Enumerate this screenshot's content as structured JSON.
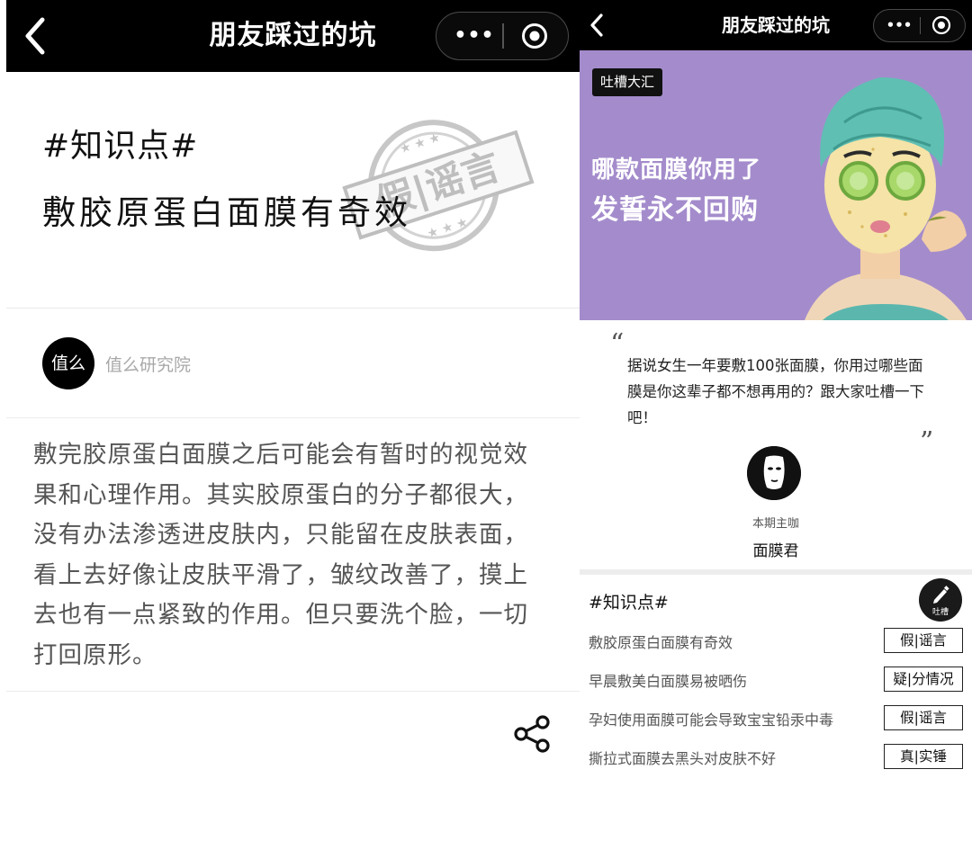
{
  "left": {
    "nav": {
      "title": "朋友踩过的坑",
      "more": "•••"
    },
    "hero": {
      "tag": "#知识点#",
      "headline": "敷胶原蛋白面膜有奇效",
      "stamp_text": "假|谣言"
    },
    "author": {
      "avatar_text": "值么",
      "name": "值么研究院"
    },
    "body": "敷完胶原蛋白面膜之后可能会有暂时的视觉效果和心理作用。其实胶原蛋白的分子都很大，没有办法渗透进皮肤内，只能留在皮肤表面，看上去好像让皮肤平滑了，皱纹改善了，摸上去也有一点紧致的作用。但只要洗个脸，一切打回原形。"
  },
  "right": {
    "nav": {
      "title": "朋友踩过的坑",
      "more": "•••"
    },
    "banner": {
      "badge": "吐槽大汇",
      "line1": "哪款面膜你用了",
      "line2": "发誓永不回购",
      "bg_color": "#a48ccc"
    },
    "quote": {
      "open": "“",
      "text": "据说女生一年要敷100张面膜，你用过哪些面膜是你这辈子都不想再用的？跟大家吐槽一下吧！",
      "close": "”"
    },
    "host": {
      "label": "本期主咖",
      "name": "面膜君"
    },
    "knowledge": {
      "tag": "#知识点#",
      "pen_label": "吐槽",
      "items": [
        {
          "text": "敷胶原蛋白面膜有奇效",
          "verdict": "假|谣言"
        },
        {
          "text": "早晨敷美白面膜易被晒伤",
          "verdict": "疑|分情况"
        },
        {
          "text": "孕妇使用面膜可能会导致宝宝铅汞中毒",
          "verdict": "假|谣言"
        },
        {
          "text": "撕拉式面膜去黑头对皮肤不好",
          "verdict": "真|实锤"
        }
      ]
    }
  }
}
